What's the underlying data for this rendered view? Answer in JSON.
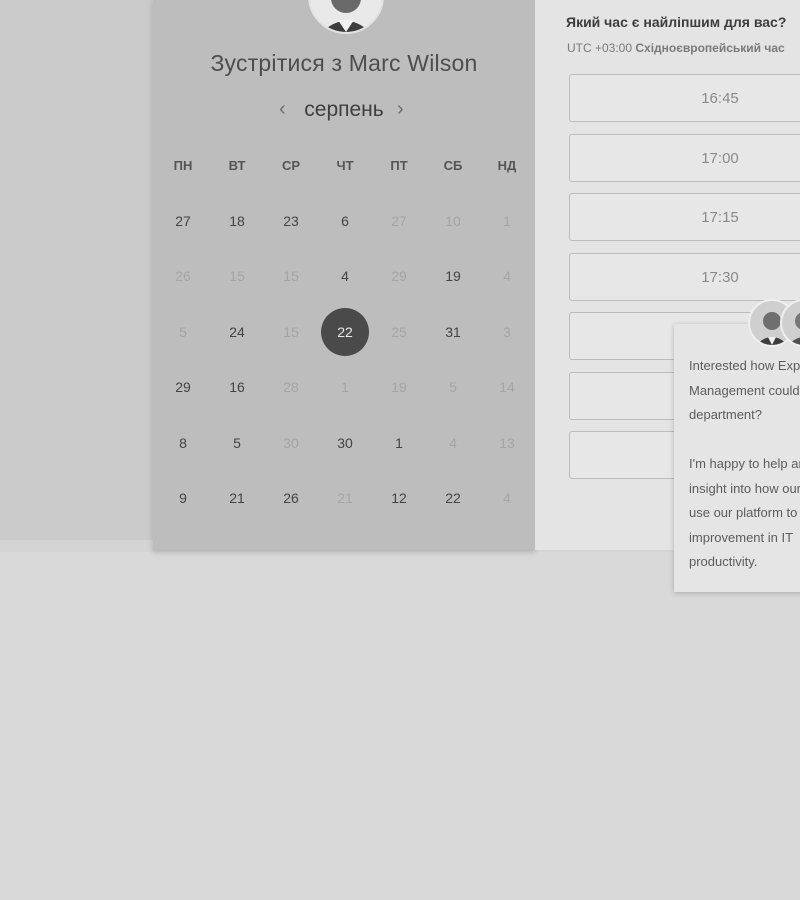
{
  "meeting": {
    "title": "Зустрітися з Marc Wilson",
    "month": "серпень",
    "prev_icon": "‹",
    "next_icon": "›"
  },
  "weekdays": [
    "ПН",
    "ВТ",
    "СР",
    "ЧТ",
    "ПТ",
    "СБ",
    "НД"
  ],
  "weeks": [
    [
      {
        "d": "27",
        "s": "enabled"
      },
      {
        "d": "18",
        "s": "enabled"
      },
      {
        "d": "23",
        "s": "enabled"
      },
      {
        "d": "6",
        "s": "enabled"
      },
      {
        "d": "27",
        "s": "muted"
      },
      {
        "d": "10",
        "s": "muted"
      },
      {
        "d": "1",
        "s": "muted"
      }
    ],
    [
      {
        "d": "26",
        "s": "muted"
      },
      {
        "d": "15",
        "s": "muted"
      },
      {
        "d": "15",
        "s": "muted"
      },
      {
        "d": "4",
        "s": "enabled"
      },
      {
        "d": "29",
        "s": "muted"
      },
      {
        "d": "19",
        "s": "enabled"
      },
      {
        "d": "4",
        "s": "muted"
      }
    ],
    [
      {
        "d": "5",
        "s": "muted"
      },
      {
        "d": "24",
        "s": "enabled"
      },
      {
        "d": "15",
        "s": "muted"
      },
      {
        "d": "22",
        "s": "selected"
      },
      {
        "d": "25",
        "s": "muted"
      },
      {
        "d": "31",
        "s": "enabled"
      },
      {
        "d": "3",
        "s": "muted"
      }
    ],
    [
      {
        "d": "29",
        "s": "enabled"
      },
      {
        "d": "16",
        "s": "enabled"
      },
      {
        "d": "28",
        "s": "muted"
      },
      {
        "d": "1",
        "s": "muted"
      },
      {
        "d": "19",
        "s": "muted"
      },
      {
        "d": "5",
        "s": "muted"
      },
      {
        "d": "14",
        "s": "muted"
      }
    ],
    [
      {
        "d": "8",
        "s": "enabled"
      },
      {
        "d": "5",
        "s": "enabled"
      },
      {
        "d": "30",
        "s": "muted"
      },
      {
        "d": "30",
        "s": "enabled"
      },
      {
        "d": "1",
        "s": "enabled"
      },
      {
        "d": "4",
        "s": "muted"
      },
      {
        "d": "13",
        "s": "muted"
      }
    ],
    [
      {
        "d": "9",
        "s": "enabled"
      },
      {
        "d": "21",
        "s": "enabled"
      },
      {
        "d": "26",
        "s": "enabled"
      },
      {
        "d": "21",
        "s": "muted"
      },
      {
        "d": "12",
        "s": "enabled"
      },
      {
        "d": "22",
        "s": "enabled"
      },
      {
        "d": "4",
        "s": "muted"
      }
    ]
  ],
  "times": {
    "question": "Який час є найліпшим для вас?",
    "timezone_prefix": "UTC +03:00 ",
    "timezone_name": "Східноєвропейський час",
    "slots": [
      "16:45",
      "17:00",
      "17:15",
      "17:30",
      "",
      "",
      ""
    ]
  },
  "chat": {
    "lines": [
      "Interested how Expert",
      "Management could",
      "department?",
      "",
      "I'm happy to help and",
      "insight into how our",
      "use our platform to",
      "improvement in IT",
      "productivity."
    ]
  },
  "colors": {
    "selected_day_bg": "#4a4a4a",
    "calendar_bg": "#bdbdbd",
    "panel_bg": "#e4e4e4"
  }
}
